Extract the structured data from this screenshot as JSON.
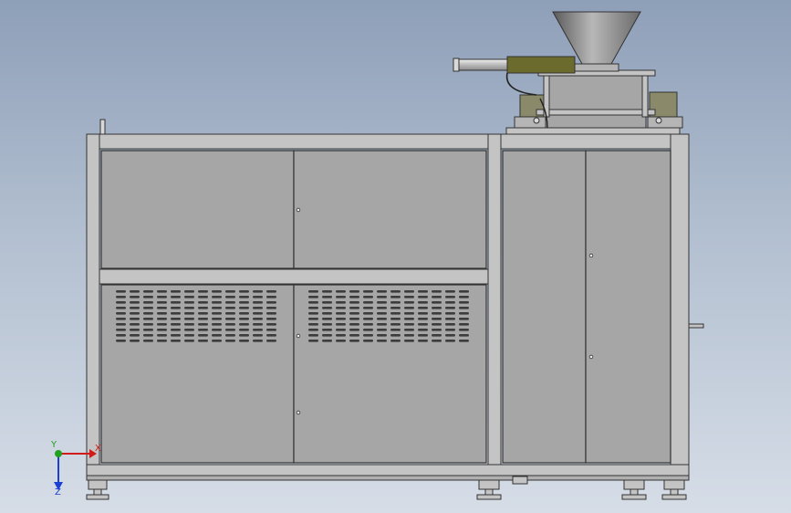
{
  "view": {
    "background_top": "#8e9fb8",
    "background_bottom": "#d6dde7"
  },
  "machine": {
    "panel_fill": "#a6a6a6",
    "frame_fill": "#c4c4c4",
    "outline": "#333333",
    "cylinder_fill": "#6b6b2e",
    "hopper_fill": "#8f8f8f",
    "mount_fill": "#8a8a6a"
  },
  "triad": {
    "x_label": "X",
    "y_label": "Y",
    "z_label": "Z",
    "x_color": "#d11a1a",
    "y_color": "#22a022",
    "z_color": "#1a3fd1"
  }
}
